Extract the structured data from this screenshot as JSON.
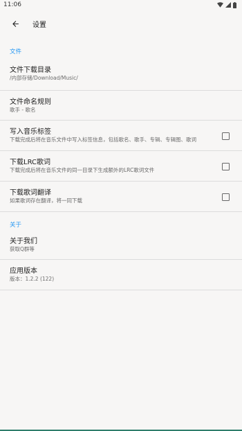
{
  "status_bar": {
    "time": "11:06"
  },
  "app_bar": {
    "title": "设置"
  },
  "sections": {
    "file": {
      "header": "文件",
      "download_dir": {
        "title": "文件下载目录",
        "summary": "/内部存储/Download/Music/"
      },
      "naming_rule": {
        "title": "文件命名规则",
        "summary": "歌手 - 歌名"
      },
      "write_tags": {
        "title": "写入音乐标签",
        "summary": "下载完成后将在音乐文件中写入标签信息，包括歌名、歌手、专辑、专辑图、歌词",
        "checked": false
      },
      "download_lrc": {
        "title": "下载LRC歌词",
        "summary": "下载完成后将在音乐文件的同一目录下生成额外的LRC歌词文件",
        "checked": false
      },
      "download_translation": {
        "title": "下载歌词翻译",
        "summary": "如果歌词存在翻译，将一同下载",
        "checked": false
      }
    },
    "about": {
      "header": "关于",
      "about_us": {
        "title": "关于我们",
        "summary": "获取Q群等"
      },
      "app_version": {
        "title": "应用版本",
        "summary": "版本：1.2.2 (122)"
      }
    }
  },
  "colors": {
    "accent": "#2196f3",
    "background": "#f7f6f5",
    "divider": "#dcdcdc"
  }
}
